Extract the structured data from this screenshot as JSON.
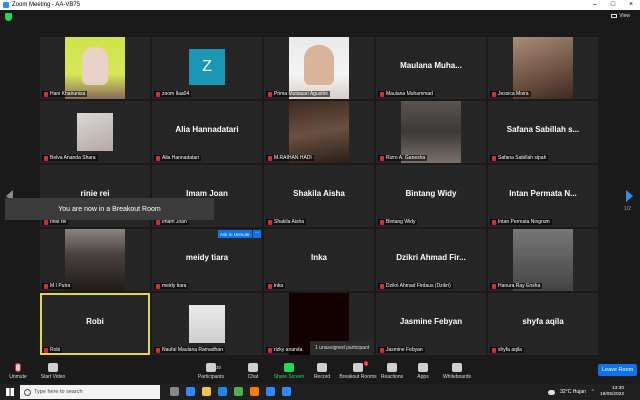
{
  "window": {
    "title": "Zoom Meeting - AA-VB75"
  },
  "view_label": "View",
  "tiles": [
    {
      "name": "Hani Khairunisa",
      "big": "",
      "photo": "p1"
    },
    {
      "name": "zoom Ilaa04",
      "big": "",
      "avatar": "Z"
    },
    {
      "name": "Prima Mutiasari Agustini",
      "big": "",
      "photo": "p3"
    },
    {
      "name": "Maulana Muhammad",
      "big": "Maulana  Muha..."
    },
    {
      "name": "Jessica Moira",
      "big": "",
      "photo": "p5"
    },
    {
      "name": "Belva Ananda Shara",
      "big": "",
      "photo": "p6"
    },
    {
      "name": "Alia Hannadatari",
      "big": "Alia Hannadatari"
    },
    {
      "name": "M.RAIHAN HADI",
      "big": "",
      "photo": "p8"
    },
    {
      "name": "Rizro A. Ganesha",
      "big": "",
      "photo": "p9"
    },
    {
      "name": "Safana Sabillah sipah",
      "big": "Safana Sabillah s..."
    },
    {
      "name": "rinie rei",
      "big": "rinie rei"
    },
    {
      "name": "Imam Joan",
      "big": "Imam Joan"
    },
    {
      "name": "Shakila Aisha",
      "big": "Shakila Aisha"
    },
    {
      "name": "Bintang Widy",
      "big": "Bintang Widy"
    },
    {
      "name": "Intan Permata Ningrum",
      "big": "Intan Permata N..."
    },
    {
      "name": "M I Putra",
      "big": "",
      "photo": "p16"
    },
    {
      "name": "meidy tiara",
      "big": "meidy tiara"
    },
    {
      "name": "inka",
      "big": "Inka"
    },
    {
      "name": "Dzikri Ahmad Firdaus (Dzikri)",
      "big": "Dzikri Ahmad Fir..."
    },
    {
      "name": "Hanura Ray Ensha",
      "big": "",
      "photo": "p20"
    },
    {
      "name": "Robi",
      "big": "Robi",
      "highlight": true
    },
    {
      "name": "Naufal Maulana Ramadhan",
      "big": "",
      "photo": "p22"
    },
    {
      "name": "rizky ananda",
      "big": "",
      "photo": "p23"
    },
    {
      "name": "Jasmine Febyan",
      "big": "Jasmine Febyan"
    },
    {
      "name": "shyfa aqila",
      "big": "shyfa aqila"
    }
  ],
  "toast": "You are now in a Breakout Room",
  "ask_unmute": "Ask to Unmute",
  "ask_more": "···",
  "unassigned": "1 unassigned participant",
  "page_indicator": "1/2",
  "toolbar": {
    "unmute": "Unmute",
    "start_video": "Start Video",
    "participants": "Participants",
    "participants_count": "30",
    "chat": "Chat",
    "share": "Share Screen",
    "record": "Record",
    "breakout": "Breakout Rooms",
    "breakout_badge": "1",
    "reactions": "Reactions",
    "apps": "Apps",
    "whiteboards": "Whiteboards",
    "leave": "Leave Room"
  },
  "taskbar": {
    "search_placeholder": "Type here to search",
    "weather": "32°C  Hujan",
    "time": "13:30",
    "date": "19/05/2022"
  },
  "colors": {
    "accent": "#0e72ed",
    "share": "#23d959",
    "highlight": "#e0d84a",
    "muted": "#e02828"
  }
}
